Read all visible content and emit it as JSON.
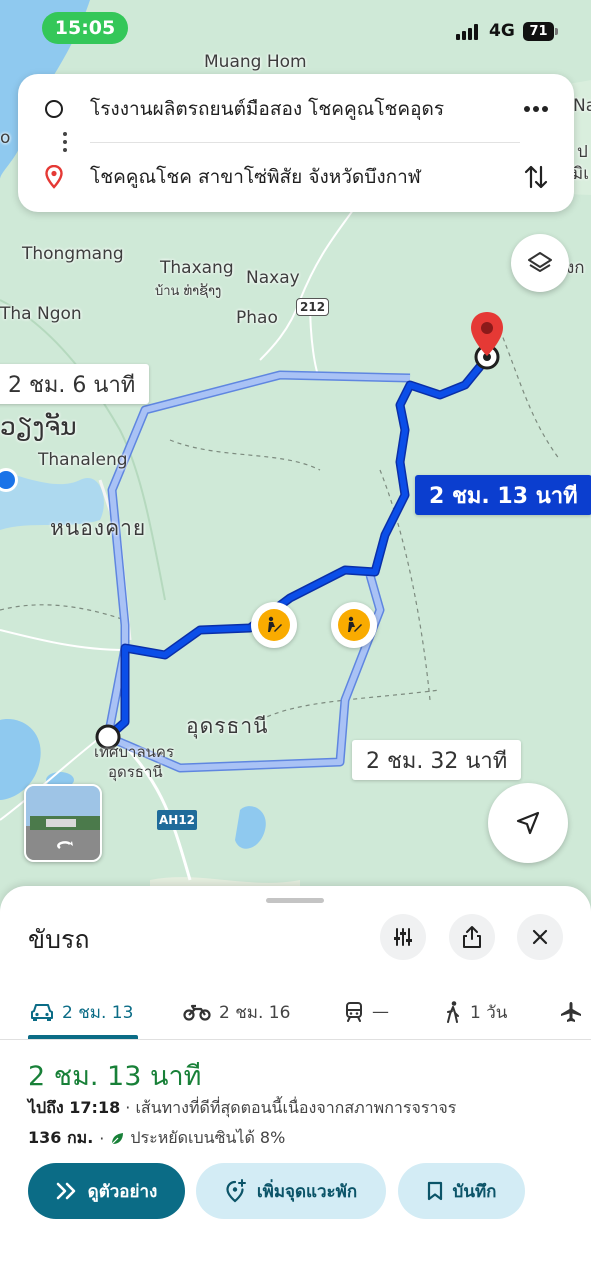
{
  "status_bar": {
    "time": "15:05",
    "network": "4G",
    "battery": "71"
  },
  "search": {
    "origin": "โรงงานผลิตรถยนต์มือสอง โชคคูณโชคอุดร",
    "destination": "โชคคูณโชค สาขาโซ่พิสัย จังหวัดบึงกาฬ",
    "origin_icon": "origin-circle-icon",
    "destination_icon": "destination-pin-icon"
  },
  "map": {
    "places": {
      "muang_hom": "Muang Hom",
      "thongmang": "Thongmang",
      "thaxang": "Thaxang",
      "thaxang_lao": "บ้าน ທ່າຊ້າງ",
      "naxay": "Naxay",
      "phao": "Phao",
      "tha_ngon": "Tha Ngon",
      "vientiane_lao": "ວຽງຈັນ",
      "thanaleng": "Thanaleng",
      "nong_khai": "หนองคาย",
      "udon_thani": "อุดรธานี",
      "udon_municipality_1": "เทศบาลนคร",
      "udon_municipality_2": "อุดรธานี",
      "edge_na": "Na",
      "edge_p": "ป",
      "edge_mi": "มิเ",
      "edge_ng": "งก",
      "edge_o": "o"
    },
    "road_shield": "212",
    "highway_shield": "AH12",
    "route_labels": {
      "alt1": "2 ชม. 6 นาที",
      "primary": "2 ชม. 13 นาที",
      "alt2": "2 ชม. 32 นาที"
    },
    "colors": {
      "route_primary": "#0b3ecf",
      "route_alt": "#8fb3f5",
      "land": "#cfe9d7",
      "water": "#8fc9ef",
      "destination_pin": "#e53935"
    }
  },
  "sheet": {
    "title": "ขับรถ",
    "modes": [
      {
        "icon": "car-icon",
        "label": "2 ชม. 13",
        "active": true
      },
      {
        "icon": "motorcycle-icon",
        "label": "2 ชม. 16",
        "active": false
      },
      {
        "icon": "train-icon",
        "label": "—",
        "active": false
      },
      {
        "icon": "walking-icon",
        "label": "1 วัน",
        "active": false
      },
      {
        "icon": "airplane-icon",
        "label": "",
        "active": false
      }
    ],
    "duration": "2 ชม. 13 นาที",
    "arrive_prefix": "ไปถึง 17:18",
    "arrive_detail": " · เส้นทางที่ดีที่สุดตอนนี้เนื่องจากสภาพการจราจร",
    "distance": "136 กม.",
    "fuel_saving": "ประหยัดเบนซินได้ 8%",
    "actions": {
      "preview": "ดูตัวอย่าง",
      "add_stop": "เพิ่มจุดแวะพัก",
      "save": "บันทึก"
    }
  }
}
